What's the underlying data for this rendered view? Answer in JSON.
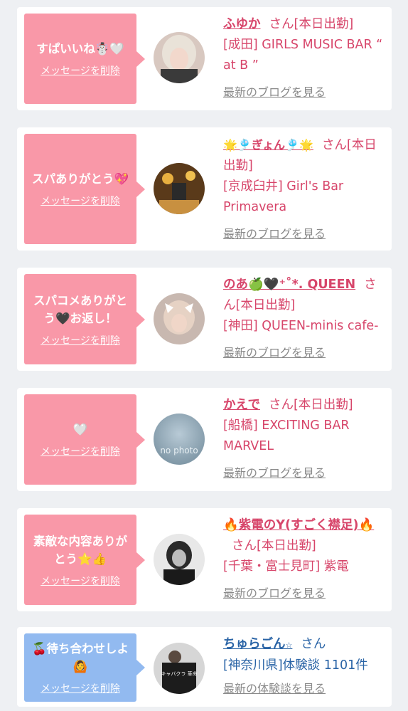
{
  "messages": [
    {
      "bubble_text": "すぱいいね☃️🤍",
      "delete_label": "メッセージを削除",
      "name": "ふゆか",
      "honorific": "さん",
      "status": "[本日出勤]",
      "shop": "[成田] GIRLS MUSIC BAR “ at B ”",
      "link": "最新のブログを見る"
    },
    {
      "bubble_text": "スパありがとう💖",
      "delete_label": "メッセージを削除",
      "name": "🌟🎐ぎょん🎐🌟",
      "honorific": "さん",
      "status": "[本日出勤]",
      "shop": "[京成臼井] Girl's Bar Primavera",
      "link": "最新のブログを見る"
    },
    {
      "bubble_text": "スパコメありがとう🖤お返し！",
      "delete_label": "メッセージを削除",
      "name": "のあ🍏🖤⁺˚*. QUEEN",
      "honorific": "さん",
      "status": "[本日出勤]",
      "shop": "[神田] QUEEN-minis cafe-",
      "link": "最新のブログを見る"
    },
    {
      "bubble_text": "🤍",
      "delete_label": "メッセージを削除",
      "name": "かえで",
      "honorific": "さん",
      "status": "[本日出勤]",
      "shop": "[船橋] EXCITING BAR MARVEL",
      "avatar_text": "no photo",
      "link": "最新のブログを見る"
    },
    {
      "bubble_text": "素敵な内容ありがとう⭐️👍",
      "delete_label": "メッセージを削除",
      "name": "🔥紫電のY(すごく襟足)🔥",
      "honorific": "さん",
      "status": "[本日出勤]",
      "shop": "[千葉・富士見町] 紫電",
      "link": "最新のブログを見る"
    },
    {
      "bubble_text": "🍒待ち合わせしよ🙆",
      "delete_label": "メッセージを削除",
      "name": "ちゅらごん",
      "name_suffix": "☆",
      "honorific": "さん",
      "shop": "[神奈川県]体験談 1101件",
      "avatar_text": "キャバクラ 革命",
      "link": "最新の体験談を見る"
    }
  ],
  "colors": {
    "pink_bubble": "#f998a8",
    "blue_bubble": "#92baf0",
    "pink_text": "#d7456a",
    "blue_text": "#2a64a6",
    "gray_link": "#8a8a8a"
  }
}
